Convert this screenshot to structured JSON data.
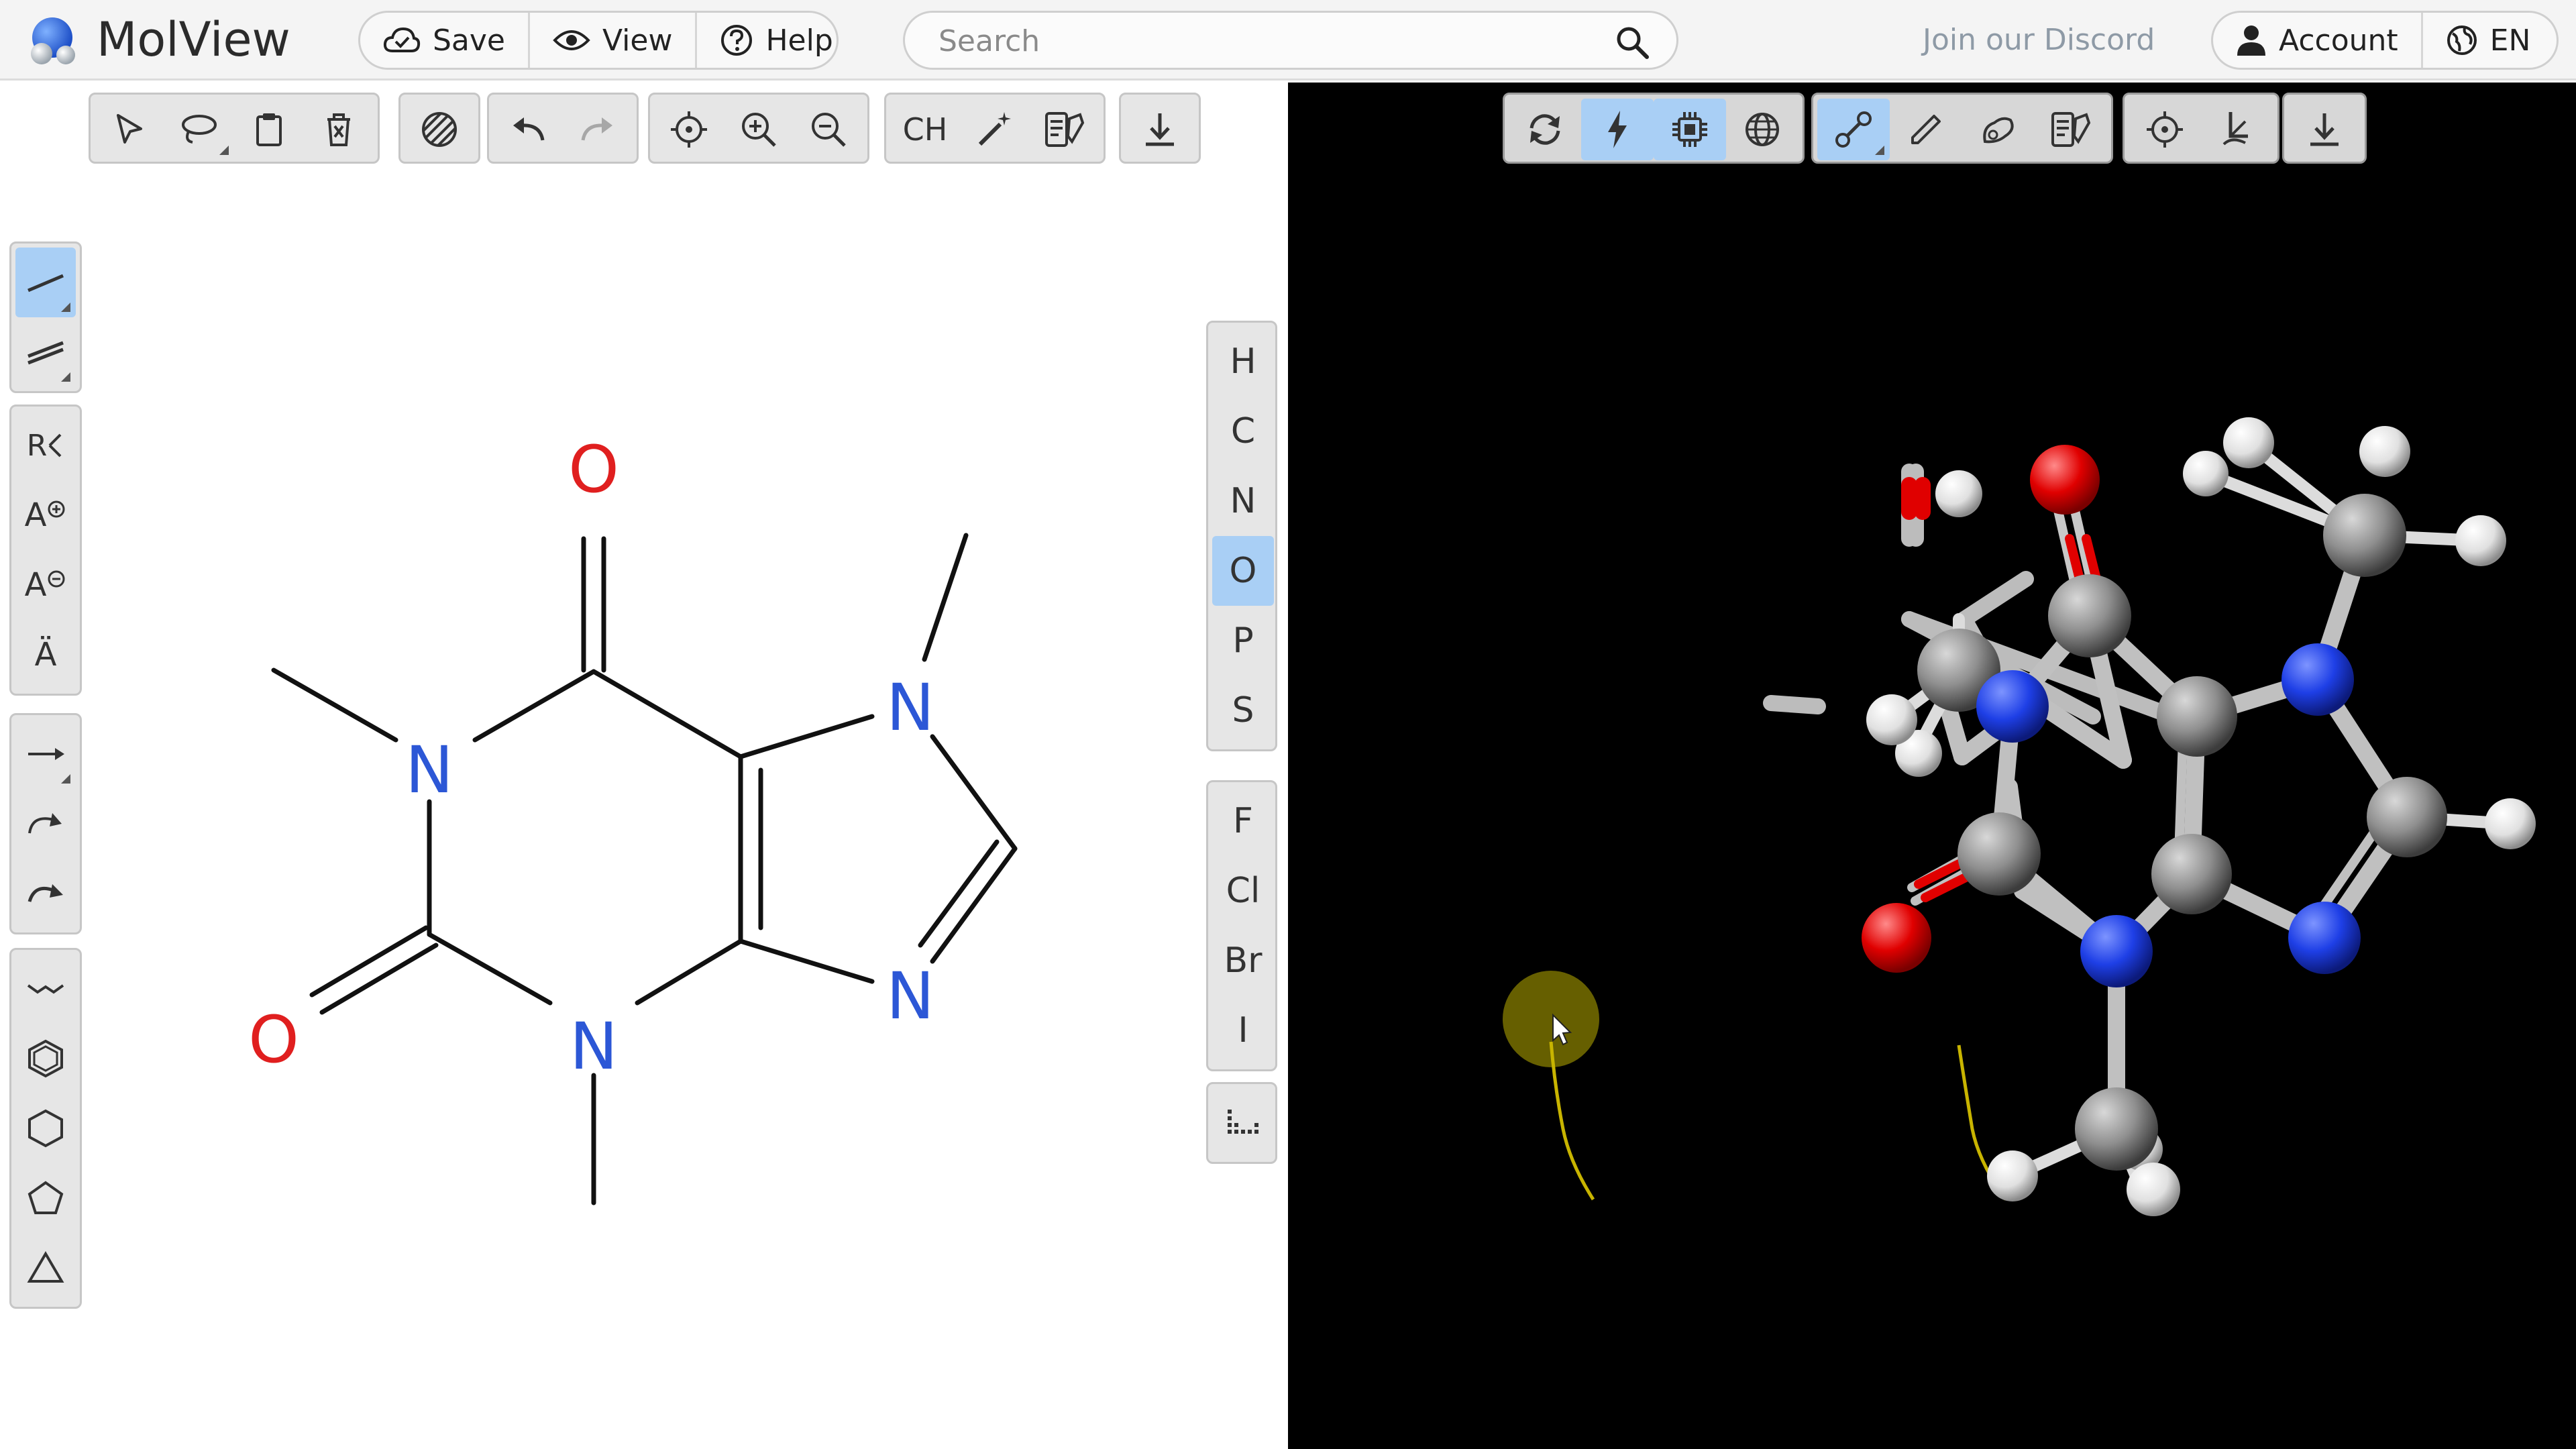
{
  "header": {
    "app_title": "MolView",
    "menu": {
      "save_label": "Save",
      "view_label": "View",
      "help_label": "Help"
    },
    "search": {
      "placeholder": "Search",
      "value": ""
    },
    "discord_label": "Join our Discord",
    "account_label": "Account",
    "language_label": "EN"
  },
  "sketcher": {
    "top_toolbar": {
      "groups": [
        [
          "select-arrow-icon",
          "lasso-select-icon",
          "clipboard-icon",
          "erase-icon"
        ],
        [
          "hatch-clean-icon"
        ],
        [
          "undo-icon",
          "redo-icon"
        ],
        [
          "center-icon",
          "zoom-in-icon",
          "zoom-out-icon"
        ],
        [
          "hydrogen-toggle",
          "magic-wand-icon",
          "info-card-icon"
        ],
        [
          "download-icon"
        ]
      ],
      "ch_label": "CH",
      "redo_disabled": true
    },
    "left_toolbar": {
      "bond_tools": [
        "single-bond-icon",
        "double-bond-icon"
      ],
      "atom_tools": [
        "r-group-icon",
        "charge-plus-icon",
        "charge-minus-icon",
        "radical-icon"
      ],
      "arrow_tools": [
        "arrow-icon",
        "curved-arrow-icon",
        "curved-arrow-alt-icon"
      ],
      "shape_tools": [
        "chain-icon",
        "benzene-icon",
        "hexagon-icon",
        "pentagon-icon",
        "triangle-icon"
      ],
      "active_tool": "single-bond-icon",
      "r_group_label": "R",
      "charge_label": "A",
      "radical_label": "Ä"
    },
    "elements": {
      "primary": [
        "H",
        "C",
        "N",
        "O",
        "P",
        "S"
      ],
      "halogens": [
        "F",
        "Cl",
        "Br",
        "I"
      ],
      "active": "O",
      "periodic_table_icon": "periodic-table-icon"
    },
    "atom_labels": {
      "o_top": "O",
      "o_left": "O",
      "n1": "N",
      "n3": "N",
      "n7": "N",
      "n9": "N"
    },
    "colors": {
      "nitrogen": "#2c57d6",
      "oxygen": "#e01f1f",
      "bond": "#111111"
    }
  },
  "viewer": {
    "toolbar": {
      "groups": [
        [
          "rotate-icon",
          "bolt-icon",
          "chip-icon",
          "globe-icon"
        ],
        [
          "ball-stick-icon",
          "stick-icon",
          "wire-icon",
          "model-card-icon"
        ],
        [
          "center-icon",
          "measure-icon"
        ],
        [
          "download-icon"
        ]
      ],
      "active": [
        "bolt-icon",
        "chip-icon",
        "ball-stick-icon"
      ]
    },
    "colors": {
      "background": "#000000",
      "carbon": "#8f8f8f",
      "nitrogen": "#1e3fe6",
      "oxygen": "#e00000",
      "hydrogen": "#e8e8e8",
      "cursor_highlight": "#6b6400"
    }
  }
}
